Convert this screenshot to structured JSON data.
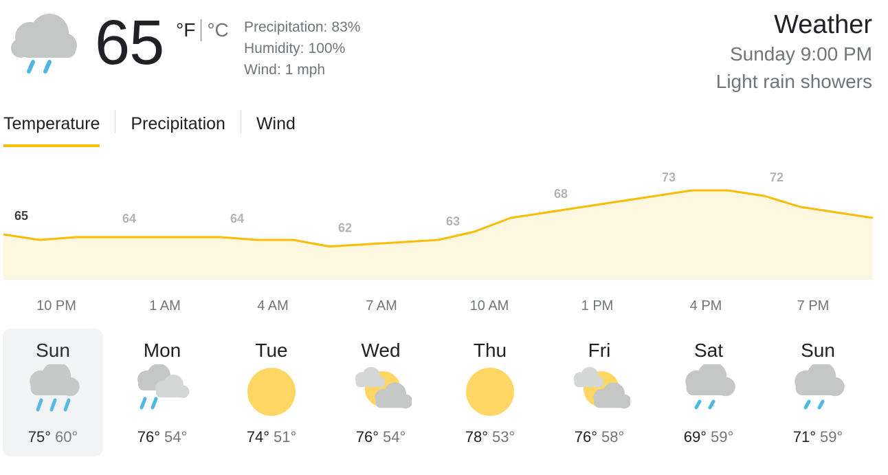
{
  "current": {
    "temperature": "65",
    "unit_f": "°F",
    "unit_c": "°C",
    "icon": "rain-cloud-icon",
    "details": [
      {
        "label": "Precipitation:",
        "value": "83%"
      },
      {
        "label": "Humidity:",
        "value": "100%"
      },
      {
        "label": "Wind:",
        "value": "1 mph"
      }
    ]
  },
  "header": {
    "title": "Weather",
    "date_time": "Sunday 9:00 PM",
    "condition": "Light rain showers"
  },
  "tabs": [
    {
      "label": "Temperature",
      "active": true
    },
    {
      "label": "Precipitation",
      "active": false
    },
    {
      "label": "Wind",
      "active": false
    }
  ],
  "colors": {
    "accent": "#fbbc04",
    "area_fill": "#fef7e0",
    "rain": "#4fb7e3",
    "sun": "#fdd663",
    "cloud": "#c4c7c5"
  },
  "chart_data": {
    "type": "area",
    "x": [
      "10 PM",
      "11 PM",
      "12 AM",
      "1 AM",
      "2 AM",
      "3 AM",
      "4 AM",
      "5 AM",
      "6 AM",
      "7 AM",
      "8 AM",
      "9 AM",
      "10 AM",
      "11 AM",
      "12 PM",
      "1 PM",
      "2 PM",
      "3 PM",
      "4 PM",
      "5 PM",
      "6 PM",
      "7 PM",
      "8 PM",
      "9 PM",
      "10 PM"
    ],
    "values": [
      65,
      64,
      64.5,
      64.5,
      64.5,
      64.5,
      64.5,
      64,
      64,
      62.8,
      63.2,
      63.6,
      64,
      65.5,
      68,
      69,
      70,
      71,
      72,
      73,
      73,
      72,
      70,
      69,
      68
    ],
    "tick_labels": [
      "10 PM",
      "1 AM",
      "4 AM",
      "7 AM",
      "10 AM",
      "1 PM",
      "4 PM",
      "7 PM"
    ],
    "point_labels": [
      "65",
      "64",
      "64",
      "62",
      "63",
      "68",
      "73",
      "72"
    ],
    "ylim": [
      50,
      80
    ],
    "grid": false
  },
  "forecast": [
    {
      "day": "Sun",
      "high": "75°",
      "low": "60°",
      "icon": "rain-cloud-icon",
      "selected": true
    },
    {
      "day": "Mon",
      "high": "76°",
      "low": "54°",
      "icon": "rain-clouds-icon",
      "selected": false
    },
    {
      "day": "Tue",
      "high": "74°",
      "low": "51°",
      "icon": "sun-icon",
      "selected": false
    },
    {
      "day": "Wed",
      "high": "76°",
      "low": "54°",
      "icon": "partly-cloudy-icon",
      "selected": false
    },
    {
      "day": "Thu",
      "high": "78°",
      "low": "53°",
      "icon": "sun-icon",
      "selected": false
    },
    {
      "day": "Fri",
      "high": "76°",
      "low": "58°",
      "icon": "partly-cloudy-icon",
      "selected": false
    },
    {
      "day": "Sat",
      "high": "69°",
      "low": "59°",
      "icon": "light-rain-cloud-icon",
      "selected": false
    },
    {
      "day": "Sun",
      "high": "71°",
      "low": "59°",
      "icon": "light-rain-cloud-icon",
      "selected": false
    }
  ]
}
